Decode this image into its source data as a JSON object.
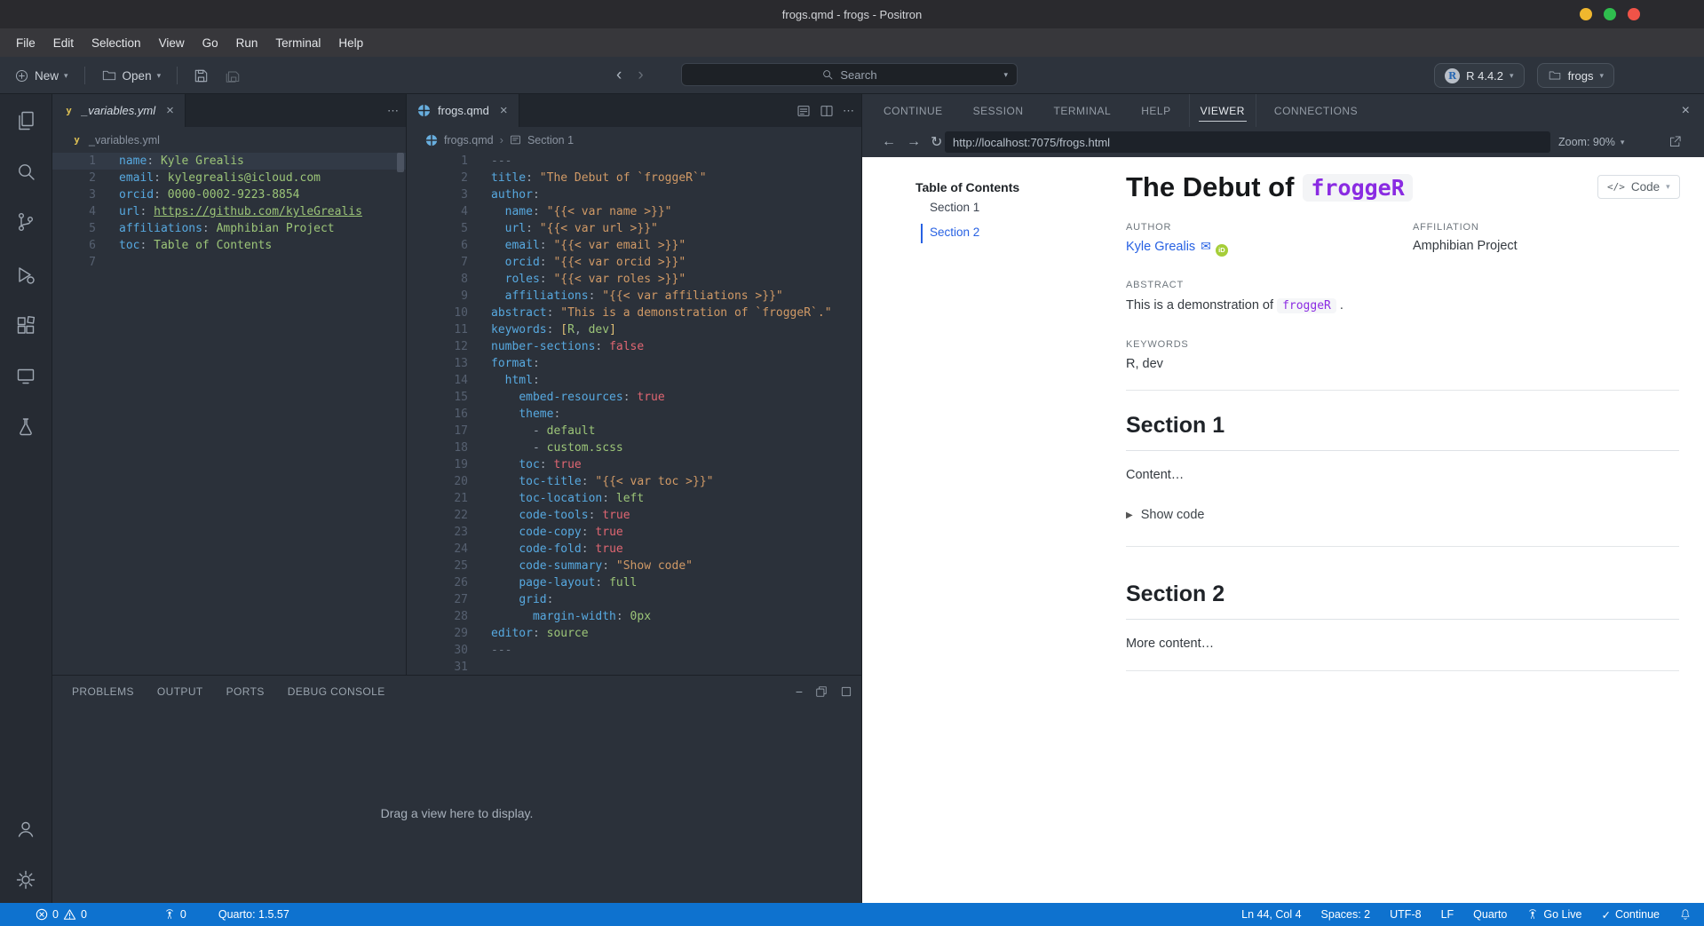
{
  "window": {
    "title": "frogs.qmd - frogs - Positron"
  },
  "menu": {
    "items": [
      "File",
      "Edit",
      "Selection",
      "View",
      "Go",
      "Run",
      "Terminal",
      "Help"
    ]
  },
  "toolbar": {
    "new_label": "New",
    "open_label": "Open",
    "search_placeholder": "Search",
    "interpreter_label": "R 4.4.2",
    "project_label": "frogs"
  },
  "colors": {
    "accent_blue": "#0e72cf",
    "quarto_purple": "#8a2be2",
    "link_blue": "#2761e3",
    "orcid_green": "#a6ce39"
  },
  "group1": {
    "tab_label": "_variables.yml",
    "breadcrumb": "_variables.yml",
    "lines": [
      {
        "n": "1",
        "hl": true,
        "seg": [
          [
            "key",
            "name"
          ],
          [
            "pun",
            ": "
          ],
          [
            "grn",
            "Kyle Grealis"
          ]
        ]
      },
      {
        "n": "2",
        "seg": [
          [
            "key",
            "email"
          ],
          [
            "pun",
            ": "
          ],
          [
            "grn",
            "kylegrealis@icloud.com"
          ]
        ]
      },
      {
        "n": "3",
        "seg": [
          [
            "key",
            "orcid"
          ],
          [
            "pun",
            ": "
          ],
          [
            "grn",
            "0000-0002-9223-8854"
          ]
        ]
      },
      {
        "n": "4",
        "seg": [
          [
            "key",
            "url"
          ],
          [
            "pun",
            ": "
          ],
          [
            "lnk",
            "https://github.com/kyleGrealis"
          ]
        ]
      },
      {
        "n": "5",
        "seg": [
          [
            "key",
            "affiliations"
          ],
          [
            "pun",
            ": "
          ],
          [
            "grn",
            "Amphibian Project"
          ]
        ]
      },
      {
        "n": "6",
        "seg": [
          [
            "key",
            "toc"
          ],
          [
            "pun",
            ": "
          ],
          [
            "grn",
            "Table of Contents"
          ]
        ]
      },
      {
        "n": "7",
        "seg": []
      }
    ]
  },
  "group2": {
    "tab_label": "frogs.qmd",
    "breadcrumb": "frogs.qmd",
    "breadcrumb2": "Section 1",
    "lines": [
      {
        "n": "1",
        "seg": [
          [
            "gry",
            "---"
          ]
        ]
      },
      {
        "n": "2",
        "seg": [
          [
            "key",
            "title"
          ],
          [
            "pun",
            ": "
          ],
          [
            "str",
            "\"The Debut of `froggeR`\""
          ]
        ]
      },
      {
        "n": "3",
        "seg": [
          [
            "key",
            "author"
          ],
          [
            "pun",
            ":"
          ]
        ]
      },
      {
        "n": "4",
        "seg": [
          [
            "pln",
            "  "
          ],
          [
            "key",
            "name"
          ],
          [
            "pun",
            ": "
          ],
          [
            "str",
            "\"{{< var name >}}\""
          ]
        ]
      },
      {
        "n": "5",
        "seg": [
          [
            "pln",
            "  "
          ],
          [
            "key",
            "url"
          ],
          [
            "pun",
            ": "
          ],
          [
            "str",
            "\"{{< var url >}}\""
          ]
        ]
      },
      {
        "n": "6",
        "seg": [
          [
            "pln",
            "  "
          ],
          [
            "key",
            "email"
          ],
          [
            "pun",
            ": "
          ],
          [
            "str",
            "\"{{< var email >}}\""
          ]
        ]
      },
      {
        "n": "7",
        "seg": [
          [
            "pln",
            "  "
          ],
          [
            "key",
            "orcid"
          ],
          [
            "pun",
            ": "
          ],
          [
            "str",
            "\"{{< var orcid >}}\""
          ]
        ]
      },
      {
        "n": "8",
        "seg": [
          [
            "pln",
            "  "
          ],
          [
            "key",
            "roles"
          ],
          [
            "pun",
            ": "
          ],
          [
            "str",
            "\"{{< var roles >}}\""
          ]
        ]
      },
      {
        "n": "9",
        "seg": [
          [
            "pln",
            "  "
          ],
          [
            "key",
            "affiliations"
          ],
          [
            "pun",
            ": "
          ],
          [
            "str",
            "\"{{< var affiliations >}}\""
          ]
        ]
      },
      {
        "n": "10",
        "seg": [
          [
            "key",
            "abstract"
          ],
          [
            "pun",
            ": "
          ],
          [
            "str",
            "\"This is a demonstration of `froggeR`.\""
          ]
        ]
      },
      {
        "n": "11",
        "seg": [
          [
            "key",
            "keywords"
          ],
          [
            "pun",
            ": "
          ],
          [
            "yel",
            "["
          ],
          [
            "grn",
            "R"
          ],
          [
            "pun",
            ", "
          ],
          [
            "grn",
            "dev"
          ],
          [
            "yel",
            "]"
          ]
        ]
      },
      {
        "n": "12",
        "seg": [
          [
            "key",
            "number-sections"
          ],
          [
            "pun",
            ": "
          ],
          [
            "red",
            "false"
          ]
        ]
      },
      {
        "n": "13",
        "seg": [
          [
            "key",
            "format"
          ],
          [
            "pun",
            ":"
          ]
        ]
      },
      {
        "n": "14",
        "seg": [
          [
            "pln",
            "  "
          ],
          [
            "key",
            "html"
          ],
          [
            "pun",
            ":"
          ]
        ]
      },
      {
        "n": "15",
        "seg": [
          [
            "pln",
            "    "
          ],
          [
            "key",
            "embed-resources"
          ],
          [
            "pun",
            ": "
          ],
          [
            "red",
            "true"
          ]
        ]
      },
      {
        "n": "16",
        "seg": [
          [
            "pln",
            "    "
          ],
          [
            "key",
            "theme"
          ],
          [
            "pun",
            ":"
          ]
        ]
      },
      {
        "n": "17",
        "seg": [
          [
            "pln",
            "      "
          ],
          [
            "pun",
            "- "
          ],
          [
            "grn",
            "default"
          ]
        ]
      },
      {
        "n": "18",
        "seg": [
          [
            "pln",
            "      "
          ],
          [
            "pun",
            "- "
          ],
          [
            "grn",
            "custom.scss"
          ]
        ]
      },
      {
        "n": "19",
        "seg": [
          [
            "pln",
            "    "
          ],
          [
            "key",
            "toc"
          ],
          [
            "pun",
            ": "
          ],
          [
            "red",
            "true"
          ]
        ]
      },
      {
        "n": "20",
        "seg": [
          [
            "pln",
            "    "
          ],
          [
            "key",
            "toc-title"
          ],
          [
            "pun",
            ": "
          ],
          [
            "str",
            "\"{{< var toc >}}\""
          ]
        ]
      },
      {
        "n": "21",
        "seg": [
          [
            "pln",
            "    "
          ],
          [
            "key",
            "toc-location"
          ],
          [
            "pun",
            ": "
          ],
          [
            "grn",
            "left"
          ]
        ]
      },
      {
        "n": "22",
        "seg": [
          [
            "pln",
            "    "
          ],
          [
            "key",
            "code-tools"
          ],
          [
            "pun",
            ": "
          ],
          [
            "red",
            "true"
          ]
        ]
      },
      {
        "n": "23",
        "seg": [
          [
            "pln",
            "    "
          ],
          [
            "key",
            "code-copy"
          ],
          [
            "pun",
            ": "
          ],
          [
            "red",
            "true"
          ]
        ]
      },
      {
        "n": "24",
        "seg": [
          [
            "pln",
            "    "
          ],
          [
            "key",
            "code-fold"
          ],
          [
            "pun",
            ": "
          ],
          [
            "red",
            "true"
          ]
        ]
      },
      {
        "n": "25",
        "seg": [
          [
            "pln",
            "    "
          ],
          [
            "key",
            "code-summary"
          ],
          [
            "pun",
            ": "
          ],
          [
            "str",
            "\"Show code\""
          ]
        ]
      },
      {
        "n": "26",
        "seg": [
          [
            "pln",
            "    "
          ],
          [
            "key",
            "page-layout"
          ],
          [
            "pun",
            ": "
          ],
          [
            "grn",
            "full"
          ]
        ]
      },
      {
        "n": "27",
        "seg": [
          [
            "pln",
            "    "
          ],
          [
            "key",
            "grid"
          ],
          [
            "pun",
            ":"
          ]
        ]
      },
      {
        "n": "28",
        "seg": [
          [
            "pln",
            "      "
          ],
          [
            "key",
            "margin-width"
          ],
          [
            "pun",
            ": "
          ],
          [
            "grn",
            "0px"
          ]
        ]
      },
      {
        "n": "29",
        "seg": [
          [
            "key",
            "editor"
          ],
          [
            "pun",
            ": "
          ],
          [
            "grn",
            "source"
          ]
        ]
      },
      {
        "n": "30",
        "seg": [
          [
            "gry",
            "---"
          ]
        ]
      },
      {
        "n": "31",
        "seg": []
      }
    ]
  },
  "panel": {
    "tabs": [
      "PROBLEMS",
      "OUTPUT",
      "PORTS",
      "DEBUG CONSOLE"
    ],
    "hint": "Drag a view here to display."
  },
  "right": {
    "tabs": [
      "CONTINUE",
      "SESSION",
      "TERMINAL",
      "HELP",
      "VIEWER",
      "CONNECTIONS"
    ],
    "active_tab": "VIEWER",
    "nav": {
      "url": "http://localhost:7075/frogs.html",
      "zoom_label": "Zoom: 90%"
    },
    "viewer": {
      "code_button": "Code",
      "toc_title": "Table of Contents",
      "toc_items": [
        "Section 1",
        "Section 2"
      ],
      "title_text": "The Debut of",
      "title_code": "froggeR",
      "author_label": "AUTHOR",
      "author_name": "Kyle Grealis",
      "affiliation_label": "AFFILIATION",
      "affiliation": "Amphibian Project",
      "abstract_label": "ABSTRACT",
      "abstract_text": "This is a demonstration of",
      "abstract_code": "froggeR",
      "abstract_tail": ".",
      "keywords_label": "KEYWORDS",
      "keywords": "R, dev",
      "section1_title": "Section 1",
      "section1_body": "Content…",
      "show_code_label": "Show code",
      "section2_title": "Section 2",
      "section2_body": "More content…"
    }
  },
  "status": {
    "errors": "0",
    "warnings": "0",
    "ports": "0",
    "quarto": "Quarto: 1.5.57",
    "line_col": "Ln 44, Col 4",
    "spaces": "Spaces: 2",
    "encoding": "UTF-8",
    "eol": "LF",
    "language": "Quarto",
    "go_live": "Go Live",
    "continue_label": "Continue"
  }
}
